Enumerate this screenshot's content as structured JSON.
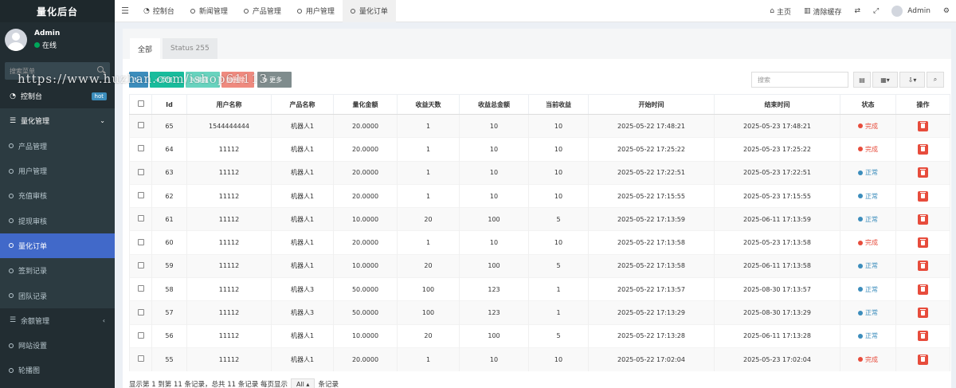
{
  "brand": "量化后台",
  "user": {
    "name": "Admin",
    "status": "在线"
  },
  "sidebar": {
    "search_placeholder": "搜索菜单",
    "items": [
      {
        "label": "控制台",
        "badge": "hot"
      },
      {
        "label": "量化管理"
      },
      {
        "label": "产品管理"
      },
      {
        "label": "用户管理"
      },
      {
        "label": "充值审核"
      },
      {
        "label": "提现审核"
      },
      {
        "label": "量化订单"
      },
      {
        "label": "签到记录"
      },
      {
        "label": "团队记录"
      },
      {
        "label": "余额管理"
      },
      {
        "label": "网站设置"
      },
      {
        "label": "轮播图"
      }
    ]
  },
  "watermark": "https://www.huzhan.com/ishop61113",
  "topbar": {
    "tabs": [
      "控制台",
      "新闻管理",
      "产品管理",
      "用户管理",
      "量化订单"
    ],
    "home": "主页",
    "clear_cache": "清除缓存",
    "user": "Admin"
  },
  "panel": {
    "tabs": [
      "全部",
      "Status 255"
    ],
    "toolbar": {
      "add": "添加",
      "edit": "编辑",
      "delete": "删除",
      "more": "更多"
    },
    "search_placeholder": "搜索"
  },
  "table": {
    "columns": [
      "Id",
      "用户名称",
      "产品名称",
      "量化金额",
      "收益天数",
      "收益总金额",
      "当前收益",
      "开始时间",
      "结束时间",
      "状态",
      "操作"
    ],
    "rows": [
      [
        "65",
        "1544444444",
        "机器人1",
        "20.0000",
        "1",
        "10",
        "10",
        "2025-05-22 17:48:21",
        "2025-05-23 17:48:21",
        "完成"
      ],
      [
        "64",
        "11112",
        "机器人1",
        "20.0000",
        "1",
        "10",
        "10",
        "2025-05-22 17:25:22",
        "2025-05-23 17:25:22",
        "完成"
      ],
      [
        "63",
        "11112",
        "机器人1",
        "20.0000",
        "1",
        "10",
        "10",
        "2025-05-22 17:22:51",
        "2025-05-23 17:22:51",
        "正常"
      ],
      [
        "62",
        "11112",
        "机器人1",
        "20.0000",
        "1",
        "10",
        "10",
        "2025-05-22 17:15:55",
        "2025-05-23 17:15:55",
        "正常"
      ],
      [
        "61",
        "11112",
        "机器人1",
        "10.0000",
        "20",
        "100",
        "5",
        "2025-05-22 17:13:59",
        "2025-06-11 17:13:59",
        "正常"
      ],
      [
        "60",
        "11112",
        "机器人1",
        "20.0000",
        "1",
        "10",
        "10",
        "2025-05-22 17:13:58",
        "2025-05-23 17:13:58",
        "完成"
      ],
      [
        "59",
        "11112",
        "机器人1",
        "10.0000",
        "20",
        "100",
        "5",
        "2025-05-22 17:13:58",
        "2025-06-11 17:13:58",
        "正常"
      ],
      [
        "58",
        "11112",
        "机器人3",
        "50.0000",
        "100",
        "123",
        "1",
        "2025-05-22 17:13:57",
        "2025-08-30 17:13:57",
        "正常"
      ],
      [
        "57",
        "11112",
        "机器人3",
        "50.0000",
        "100",
        "123",
        "1",
        "2025-05-22 17:13:29",
        "2025-08-30 17:13:29",
        "正常"
      ],
      [
        "56",
        "11112",
        "机器人1",
        "10.0000",
        "20",
        "100",
        "5",
        "2025-05-22 17:13:28",
        "2025-06-11 17:13:28",
        "正常"
      ],
      [
        "55",
        "11112",
        "机器人1",
        "20.0000",
        "1",
        "10",
        "10",
        "2025-05-22 17:02:04",
        "2025-05-23 17:02:04",
        "完成"
      ]
    ]
  },
  "footer": {
    "summary": "显示第 1 到第 11 条记录，总共 11 条记录 每页显示",
    "page_size": "All",
    "suffix": "条记录"
  },
  "colors": {
    "sidebar_bg": "#222d32",
    "active_blue": "#4169c9",
    "done_red": "#e74c3c",
    "normal_blue": "#3c8dbc",
    "add_green": "#18bc9c"
  }
}
